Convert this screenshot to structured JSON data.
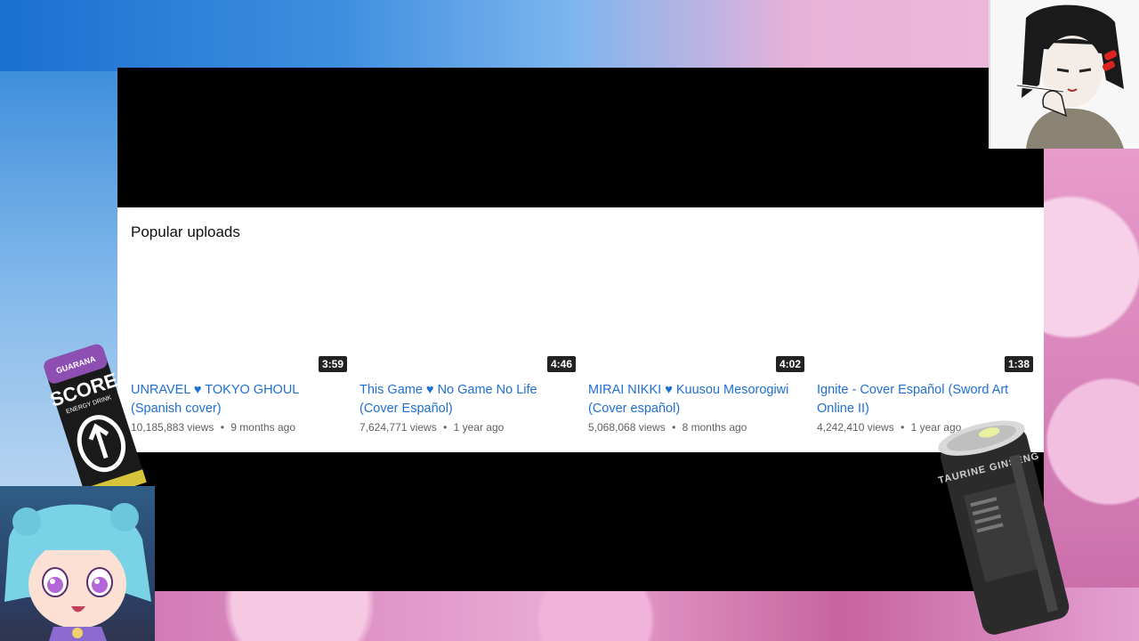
{
  "section": {
    "title": "Popular uploads"
  },
  "videos": [
    {
      "title": "UNRAVEL ♥ TOKYO GHOUL (Spanish cover)",
      "duration": "3:59",
      "views": "10,185,883 views",
      "age": "9 months ago"
    },
    {
      "title": "This Game ♥ No Game No Life (Cover Español)",
      "duration": "4:46",
      "views": "7,624,771 views",
      "age": "1 year ago"
    },
    {
      "title": "MIRAI NIKKI ♥ Kuusou Mesorogiwi (Cover español)",
      "duration": "4:02",
      "views": "5,068,068 views",
      "age": "8 months ago"
    },
    {
      "title": "Ignite - Cover Español (Sword Art Online II)",
      "duration": "1:38",
      "views": "4,242,410 views",
      "age": "1 year ago"
    }
  ],
  "separator": "•",
  "decor": {
    "can_left_brand": "SCORE",
    "can_left_flavor": "GUARANA",
    "can_left_subtitle": "ENERGY DRINK",
    "can_right_text": "TAURINE GINSENG"
  },
  "colors": {
    "link": "#1f6fd1",
    "meta": "#606060",
    "duration_bg": "#222222"
  }
}
